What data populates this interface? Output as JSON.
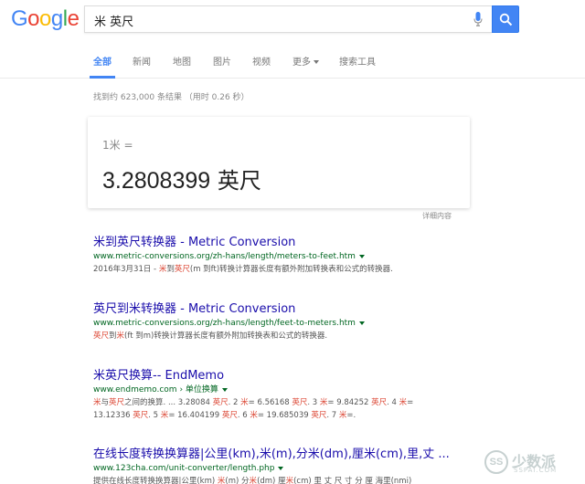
{
  "logo": {
    "letters": [
      "G",
      "o",
      "o",
      "g",
      "l",
      "e"
    ],
    "colors": [
      "#4285f4",
      "#ea4335",
      "#fbbc05",
      "#4285f4",
      "#34a853",
      "#ea4335"
    ]
  },
  "search": {
    "query": "米 英尺",
    "mic_icon": "microphone-icon",
    "button_icon": "magnifier-icon",
    "button_color": "#4285f4"
  },
  "tabs": {
    "all": "全部",
    "news": "新闻",
    "maps": "地图",
    "images": "图片",
    "videos": "视频",
    "more": "更多",
    "tools": "搜索工具"
  },
  "stats": "找到约 623,000 条结果 （用时 0.26 秒）",
  "converter": {
    "from": "1米 =",
    "result_value": "3.2808399",
    "result_unit": "英尺",
    "details": "详细内容"
  },
  "results": [
    {
      "title": "米到英尺转换器 - Metric Conversion",
      "url": "www.metric-conversions.org/zh-hans/length/meters-to-feet.htm",
      "snippet": [
        {
          "t": "2016年3月31日 - ",
          "h": false
        },
        {
          "t": "米",
          "h": true
        },
        {
          "t": "到",
          "h": false
        },
        {
          "t": "英尺",
          "h": true
        },
        {
          "t": "(m 到ft)转换计算器长度有额外附加转换表和公式的转换器.",
          "h": false
        }
      ]
    },
    {
      "title": "英尺到米转换器 - Metric Conversion",
      "url": "www.metric-conversions.org/zh-hans/length/feet-to-meters.htm",
      "snippet": [
        {
          "t": "英尺",
          "h": true
        },
        {
          "t": "到",
          "h": false
        },
        {
          "t": "米",
          "h": true
        },
        {
          "t": "(ft 到m)转换计算器长度有额外附加转换表和公式的转换器.",
          "h": false
        }
      ]
    },
    {
      "title": "米英尺换算-- EndMemo",
      "url": "www.endmemo.com",
      "crumb": " › 单位换算",
      "snippet": [
        {
          "t": "米",
          "h": true
        },
        {
          "t": "与",
          "h": false
        },
        {
          "t": "英尺",
          "h": true
        },
        {
          "t": "之间的换算. ... 3.28084 ",
          "h": false
        },
        {
          "t": "英尺",
          "h": true
        },
        {
          "t": ". 2 ",
          "h": false
        },
        {
          "t": "米",
          "h": true
        },
        {
          "t": "= 6.56168 ",
          "h": false
        },
        {
          "t": "英尺",
          "h": true
        },
        {
          "t": ". 3 ",
          "h": false
        },
        {
          "t": "米",
          "h": true
        },
        {
          "t": "= 9.84252 ",
          "h": false
        },
        {
          "t": "英尺",
          "h": true
        },
        {
          "t": ". 4 ",
          "h": false
        },
        {
          "t": "米",
          "h": true
        },
        {
          "t": "=",
          "h": false
        }
      ],
      "snippet2": [
        {
          "t": "13.12336 ",
          "h": false
        },
        {
          "t": "英尺",
          "h": true
        },
        {
          "t": ". 5 ",
          "h": false
        },
        {
          "t": "米",
          "h": true
        },
        {
          "t": "= 16.404199 ",
          "h": false
        },
        {
          "t": "英尺",
          "h": true
        },
        {
          "t": ". 6 ",
          "h": false
        },
        {
          "t": "米",
          "h": true
        },
        {
          "t": "= 19.685039 ",
          "h": false
        },
        {
          "t": "英尺",
          "h": true
        },
        {
          "t": ". 7 ",
          "h": false
        },
        {
          "t": "米",
          "h": true
        },
        {
          "t": "=.",
          "h": false
        }
      ]
    },
    {
      "title": "在线长度转换换算器|公里(km),米(m),分米(dm),厘米(cm),里,丈 ...",
      "url": "www.123cha.com/unit-converter/length.php",
      "snippet": [
        {
          "t": "提供在线长度转换换算器|公里(km) ",
          "h": false
        },
        {
          "t": "米",
          "h": true
        },
        {
          "t": "(m) 分",
          "h": false
        },
        {
          "t": "米",
          "h": true
        },
        {
          "t": "(dm) 厘",
          "h": false
        },
        {
          "t": "米",
          "h": true
        },
        {
          "t": "(cm) 里 丈 尺 寸 分 厘 海里(nmi)",
          "h": false
        }
      ]
    }
  ],
  "watermark": {
    "logo": "SS",
    "name": "少数派",
    "site": "SSPAI.COM"
  }
}
